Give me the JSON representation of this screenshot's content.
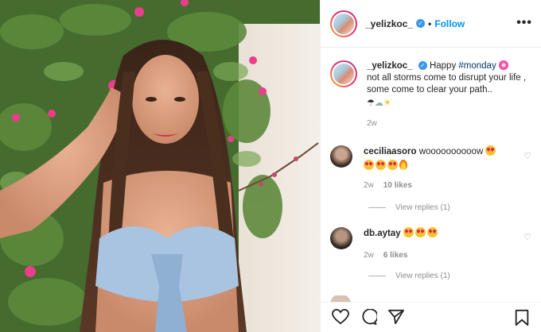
{
  "post": {
    "username": "_yelizkoc_",
    "follow_label": "Follow",
    "separator": "•"
  },
  "caption": {
    "username": "_yelizkoc_",
    "text_before": "Happy ",
    "hashtag": "#monday",
    "body": "not all storms come to disrupt your life , some come to clear your path..",
    "age": "2w"
  },
  "comments": [
    {
      "username": "ceciliaasoro",
      "text": "woooooooooow",
      "age": "2w",
      "likes": "10 likes",
      "view_replies": "View replies (1)"
    },
    {
      "username": "db.aytay",
      "text": "",
      "age": "2w",
      "likes": "6 likes",
      "view_replies": "View replies (1)"
    }
  ],
  "icons": [
    "more-options-icon",
    "verified-badge-icon",
    "heart-icon",
    "comment-icon",
    "share-icon",
    "bookmark-icon"
  ],
  "colors": {
    "link": "#0095f6",
    "muted": "#8e8e8e",
    "text": "#262626"
  }
}
